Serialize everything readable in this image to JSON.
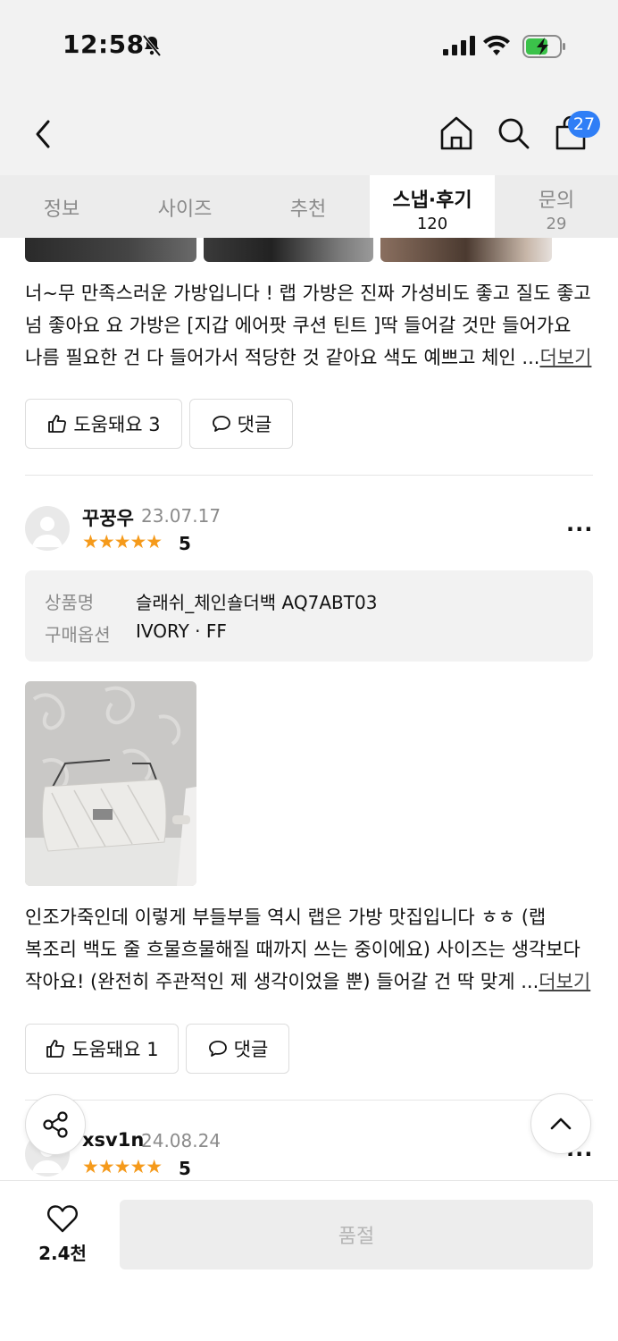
{
  "status_bar": {
    "time": "12:58",
    "battery_charging": true
  },
  "header": {
    "cart_count": "27",
    "icons": [
      "back-icon",
      "home-icon",
      "search-icon",
      "cart-icon"
    ]
  },
  "tabs": [
    {
      "label": "정보",
      "count": ""
    },
    {
      "label": "사이즈",
      "count": ""
    },
    {
      "label": "추천",
      "count": ""
    },
    {
      "label": "스냅·후기",
      "count": "120",
      "active": true
    },
    {
      "label": "문의",
      "count": "29"
    }
  ],
  "review1": {
    "text_line1": "너~무 만족스러운 가방입니다 ! 랩 가방은 진짜 가성비도 좋고 질도 좋고",
    "text_line2": "넘 좋아요 요 가방은 [지갑 에어팟 쿠션 틴트 ]딱 들어갈 것만 들어가요",
    "text_line3": "나름 필요한 건 다 들어가서 적당한 것 같아요 색도 예쁘고 체인 ...",
    "more": "더보기",
    "helpful_label": "도움돼요 3",
    "comment_label": "댓글"
  },
  "review2": {
    "username": "꾸꿍우",
    "date": "23.07.17",
    "stars": "★★★★★",
    "score": "5",
    "product_label": "상품명",
    "product_value": "슬래쉬_체인숄더백 AQ7ABT03",
    "option_label": "구매옵션",
    "option_value": "IVORY · FF",
    "text_line1": "인조가죽인데 이렇게 부들부들 역시 랩은 가방 맛집입니다 ㅎㅎ (랩",
    "text_line2": "복조리 백도 줄 흐물흐물해질 때까지 쓰는 중이에요) 사이즈는 생각보다",
    "text_line3": "작아요! (완전히 주관적인 제 생각이었을 뿐) 들어갈 건 딱 맞게 ...",
    "more": "더보기",
    "helpful_label": "도움돼요 1",
    "comment_label": "댓글"
  },
  "review3": {
    "username": "xsv1n",
    "date": "24.08.24",
    "stars": "★★★★★",
    "score": "5"
  },
  "bottom_bar": {
    "likes": "2.4천",
    "soldout_label": "품절"
  },
  "colors": {
    "accent_blue": "#2f7ef6",
    "star": "#f59a1b"
  }
}
